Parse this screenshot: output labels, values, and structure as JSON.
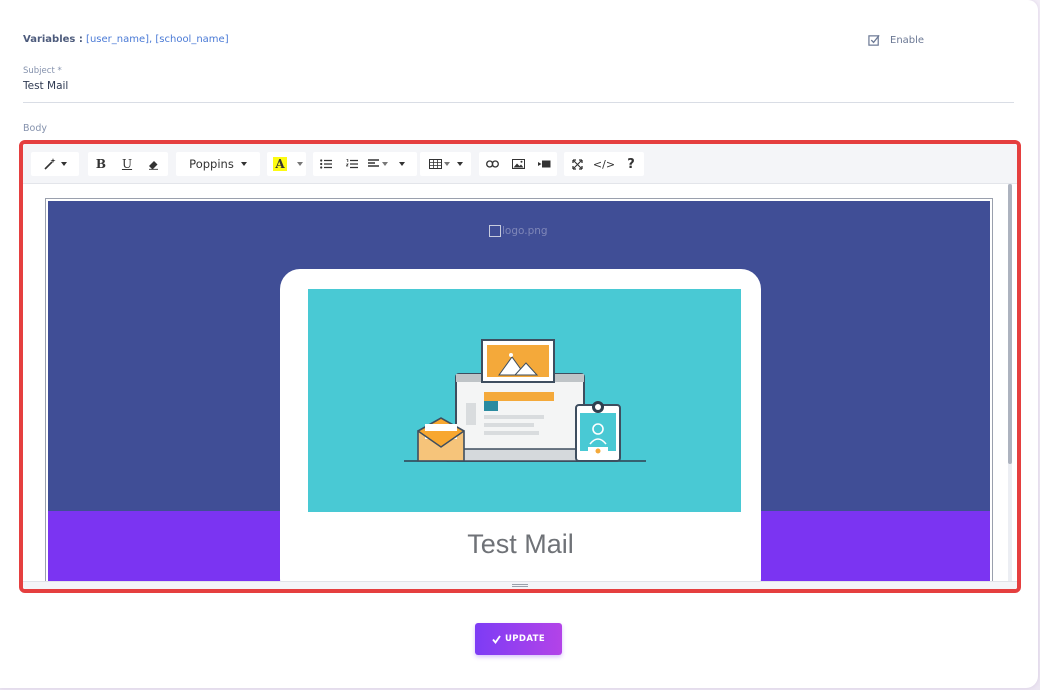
{
  "variables": {
    "label": "Variables :",
    "values": "[user_name], [school_name]"
  },
  "enable": {
    "label": "Enable"
  },
  "subject": {
    "label": "Subject *",
    "value": "Test Mail"
  },
  "body": {
    "label": "Body"
  },
  "toolbar": {
    "font_name": "Poppins",
    "bold": "B",
    "underline": "U",
    "color_letter": "A",
    "code": "</>",
    "help": "?",
    "icons": [
      "magic-icon",
      "bold-icon",
      "underline-icon",
      "eraser-icon",
      "font-family-dropdown",
      "font-color-icon",
      "unordered-list-icon",
      "ordered-list-icon",
      "align-icon",
      "table-icon",
      "link-icon",
      "picture-icon",
      "video-icon",
      "fullscreen-icon",
      "code-view-icon",
      "help-icon"
    ]
  },
  "email": {
    "logo_alt": "logo.png",
    "title": "Test Mail",
    "colors": {
      "header_bg": "#404e96",
      "band_bg": "#7b34f2",
      "hero_bg": "#49c9d4"
    }
  },
  "actions": {
    "update_label": "UPDATE"
  },
  "colors": {
    "highlight_border": "#e53f3f",
    "accent": "#7b34f2",
    "link": "#4a7ad6"
  }
}
